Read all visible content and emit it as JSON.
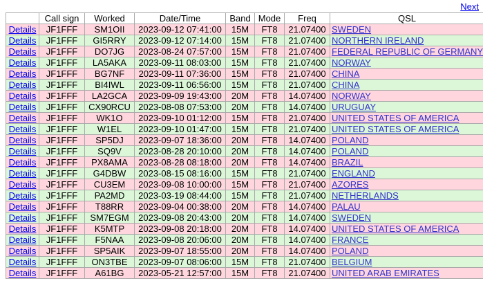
{
  "nav": {
    "next_label": "Next"
  },
  "table": {
    "headers": [
      "",
      "Call sign",
      "Worked",
      "Date/Time",
      "Band",
      "Mode",
      "Freq",
      "QSL"
    ],
    "row_colors": {
      "pink": "#ffd6dd",
      "green": "#dbf7d8"
    },
    "rows": [
      {
        "details": "Details",
        "call": "JF1FFF",
        "worked": "SM1OII",
        "datetime": "2023-09-12 07:41:00",
        "band": "15M",
        "mode": "FT8",
        "freq": "21.07400",
        "qsl": "SWEDEN",
        "color": "pink"
      },
      {
        "details": "Details",
        "call": "JF1FFF",
        "worked": "GI5RRY",
        "datetime": "2023-09-12 07:14:00",
        "band": "15M",
        "mode": "FT8",
        "freq": "21.07400",
        "qsl": "NORTHERN IRELAND",
        "color": "green"
      },
      {
        "details": "Details",
        "call": "JF1FFF",
        "worked": "DO7JG",
        "datetime": "2023-08-24 07:57:00",
        "band": "15M",
        "mode": "FT8",
        "freq": "21.07400",
        "qsl": "FEDERAL REPUBLIC OF GERMANY",
        "color": "pink"
      },
      {
        "details": "Details",
        "call": "JF1FFF",
        "worked": "LA5AKA",
        "datetime": "2023-09-11 08:03:00",
        "band": "15M",
        "mode": "FT8",
        "freq": "21.07400",
        "qsl": "NORWAY",
        "color": "green"
      },
      {
        "details": "Details",
        "call": "JF1FFF",
        "worked": "BG7NF",
        "datetime": "2023-09-11 07:36:00",
        "band": "15M",
        "mode": "FT8",
        "freq": "21.07400",
        "qsl": "CHINA",
        "color": "pink"
      },
      {
        "details": "Details",
        "call": "JF1FFF",
        "worked": "BI4IWL",
        "datetime": "2023-09-11 06:56:00",
        "band": "15M",
        "mode": "FT8",
        "freq": "21.07400",
        "qsl": "CHINA",
        "color": "green"
      },
      {
        "details": "Details",
        "call": "JF1FFF",
        "worked": "LA2GCA",
        "datetime": "2023-09-09 19:43:00",
        "band": "20M",
        "mode": "FT8",
        "freq": "14.07400",
        "qsl": "NORWAY",
        "color": "pink"
      },
      {
        "details": "Details",
        "call": "JF1FFF",
        "worked": "CX90RCU",
        "datetime": "2023-08-08 07:53:00",
        "band": "20M",
        "mode": "FT8",
        "freq": "14.07400",
        "qsl": "URUGUAY",
        "color": "green"
      },
      {
        "details": "Details",
        "call": "JF1FFF",
        "worked": "WK1O",
        "datetime": "2023-09-10 01:12:00",
        "band": "15M",
        "mode": "FT8",
        "freq": "21.07400",
        "qsl": "UNITED STATES OF AMERICA",
        "color": "pink"
      },
      {
        "details": "Details",
        "call": "JF1FFF",
        "worked": "W1EL",
        "datetime": "2023-09-10 01:47:00",
        "band": "15M",
        "mode": "FT8",
        "freq": "21.07400",
        "qsl": "UNITED STATES OF AMERICA",
        "color": "green"
      },
      {
        "details": "Details",
        "call": "JF1FFF",
        "worked": "SP5DJ",
        "datetime": "2023-09-07 18:36:00",
        "band": "20M",
        "mode": "FT8",
        "freq": "14.07400",
        "qsl": "POLAND",
        "color": "pink"
      },
      {
        "details": "Details",
        "call": "JF1FFF",
        "worked": "SQ9V",
        "datetime": "2023-08-28 20:10:00",
        "band": "20M",
        "mode": "FT8",
        "freq": "14.07400",
        "qsl": "POLAND",
        "color": "green"
      },
      {
        "details": "Details",
        "call": "JF1FFF",
        "worked": "PX8AMA",
        "datetime": "2023-08-28 08:18:00",
        "band": "20M",
        "mode": "FT8",
        "freq": "14.07400",
        "qsl": "BRAZIL",
        "color": "pink"
      },
      {
        "details": "Details",
        "call": "JF1FFF",
        "worked": "G4DBW",
        "datetime": "2023-08-15 08:16:00",
        "band": "15M",
        "mode": "FT8",
        "freq": "21.07400",
        "qsl": "ENGLAND",
        "color": "green"
      },
      {
        "details": "Details",
        "call": "JF1FFF",
        "worked": "CU3EM",
        "datetime": "2023-09-08 10:00:00",
        "band": "15M",
        "mode": "FT8",
        "freq": "21.07400",
        "qsl": "AZORES",
        "color": "pink"
      },
      {
        "details": "Details",
        "call": "JF1FFF",
        "worked": "PA2MD",
        "datetime": "2023-03-19 08:44:00",
        "band": "15M",
        "mode": "FT8",
        "freq": "21.07400",
        "qsl": "NETHERLANDS",
        "color": "green"
      },
      {
        "details": "Details",
        "call": "JF1FFF",
        "worked": "T88RR",
        "datetime": "2023-09-04 00:38:00",
        "band": "20M",
        "mode": "FT8",
        "freq": "14.07400",
        "qsl": "PALAU",
        "color": "pink"
      },
      {
        "details": "Details",
        "call": "JF1FFF",
        "worked": "SM7EGM",
        "datetime": "2023-09-08 20:43:00",
        "band": "20M",
        "mode": "FT8",
        "freq": "14.07400",
        "qsl": "SWEDEN",
        "color": "green"
      },
      {
        "details": "Details",
        "call": "JF1FFF",
        "worked": "K5MTP",
        "datetime": "2023-09-08 20:18:00",
        "band": "20M",
        "mode": "FT8",
        "freq": "14.07400",
        "qsl": "UNITED STATES OF AMERICA",
        "color": "pink"
      },
      {
        "details": "Details",
        "call": "JF1FFF",
        "worked": "F5NAA",
        "datetime": "2023-09-08 20:06:00",
        "band": "20M",
        "mode": "FT8",
        "freq": "14.07400",
        "qsl": "FRANCE",
        "color": "green"
      },
      {
        "details": "Details",
        "call": "JF1FFF",
        "worked": "SP5AIK",
        "datetime": "2023-09-07 18:55:00",
        "band": "20M",
        "mode": "FT8",
        "freq": "14.07400",
        "qsl": "POLAND",
        "color": "pink"
      },
      {
        "details": "Details",
        "call": "JF1FFF",
        "worked": "ON3TBE",
        "datetime": "2023-09-07 08:06:00",
        "band": "15M",
        "mode": "FT8",
        "freq": "21.07400",
        "qsl": "BELGIUM",
        "color": "green"
      },
      {
        "details": "Details",
        "call": "JF1FFF",
        "worked": "A61BG",
        "datetime": "2023-05-21 12:57:00",
        "band": "15M",
        "mode": "FT8",
        "freq": "21.07400",
        "qsl": "UNITED ARAB EMIRATES",
        "color": "pink"
      }
    ]
  }
}
